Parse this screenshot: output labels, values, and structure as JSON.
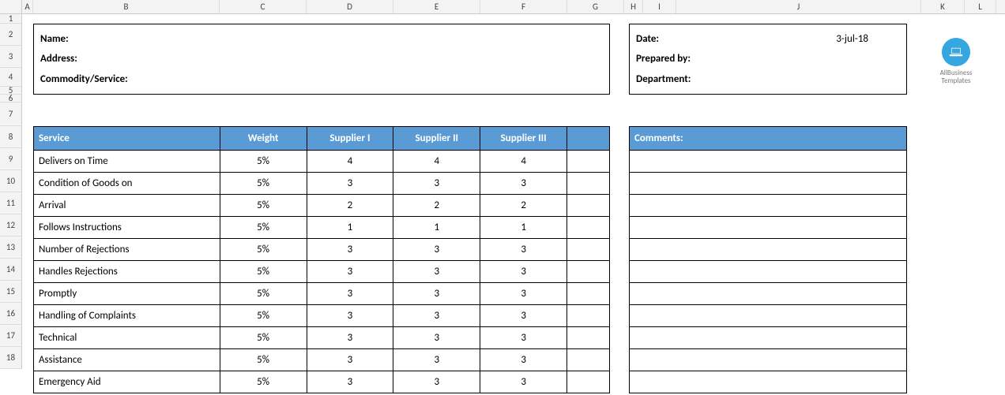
{
  "columns": [
    "A",
    "B",
    "C",
    "D",
    "E",
    "F",
    "G",
    "H",
    "I",
    "J",
    "K",
    "L"
  ],
  "row_numbers": [
    1,
    2,
    3,
    4,
    5,
    6,
    7,
    8,
    9,
    10,
    11,
    12,
    13,
    14,
    15,
    16,
    17,
    18
  ],
  "info_left": {
    "name_label": "Name:",
    "name_value": "",
    "address_label": "Address:",
    "address_value": "",
    "commodity_label": "Commodity/Service:",
    "commodity_value": ""
  },
  "info_right": {
    "date_label": "Date:",
    "date_value": "3-jul-18",
    "prepared_label": "Prepared by:",
    "prepared_value": "",
    "department_label": "Department:",
    "department_value": ""
  },
  "logo": {
    "line1": "AllBusiness",
    "line2": "Templates"
  },
  "table": {
    "headers": [
      "Service",
      "Weight",
      "Supplier I",
      "Supplier II",
      "Supplier III",
      ""
    ],
    "rows": [
      {
        "service": "Delivers on Time",
        "weight": "5%",
        "s1": "4",
        "s2": "4",
        "s3": "4"
      },
      {
        "service": "Condition of Goods on",
        "weight": "5%",
        "s1": "3",
        "s2": "3",
        "s3": "3"
      },
      {
        "service": "Arrival",
        "weight": "5%",
        "s1": "2",
        "s2": "2",
        "s3": "2"
      },
      {
        "service": "Follows Instructions",
        "weight": "5%",
        "s1": "1",
        "s2": "1",
        "s3": "1"
      },
      {
        "service": "Number of Rejections",
        "weight": "5%",
        "s1": "3",
        "s2": "3",
        "s3": "3"
      },
      {
        "service": "Handles Rejections",
        "weight": "5%",
        "s1": "3",
        "s2": "3",
        "s3": "3"
      },
      {
        "service": "Promptly",
        "weight": "5%",
        "s1": "3",
        "s2": "3",
        "s3": "3"
      },
      {
        "service": "Handling of Complaints",
        "weight": "5%",
        "s1": "3",
        "s2": "3",
        "s3": "3"
      },
      {
        "service": "Technical",
        "weight": "5%",
        "s1": "3",
        "s2": "3",
        "s3": "3"
      },
      {
        "service": "Assistance",
        "weight": "5%",
        "s1": "3",
        "s2": "3",
        "s3": "3"
      },
      {
        "service": "Emergency Aid",
        "weight": "5%",
        "s1": "3",
        "s2": "3",
        "s3": "3"
      }
    ]
  },
  "comments_header": "Comments:"
}
